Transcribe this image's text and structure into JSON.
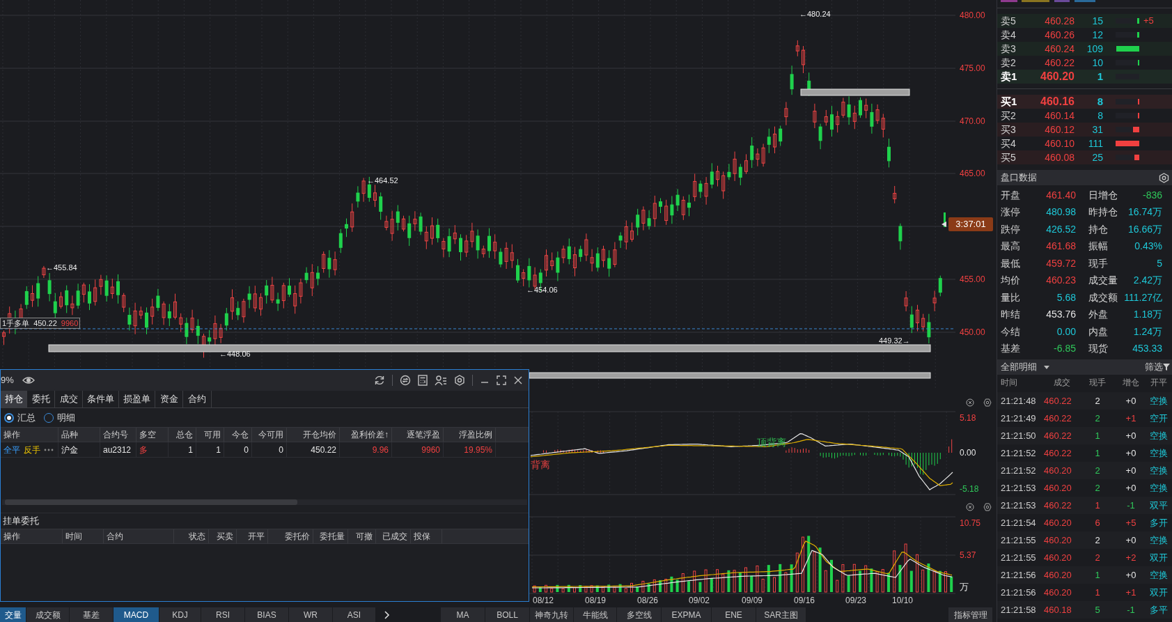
{
  "price_chart": {
    "y_axis": [
      "480.00",
      "475.00",
      "470.00",
      "465.00",
      "455.00",
      "450.00"
    ],
    "extremes": [
      {
        "text": "←480.24"
      },
      {
        "text": "←464.52"
      },
      {
        "text": "←455.84"
      },
      {
        "text": "←454.06"
      },
      {
        "text": "←448.06"
      },
      {
        "text": "449.32→"
      }
    ],
    "position_tag": {
      "label": "1手多单",
      "price": "450.22",
      "pnl": "9960"
    },
    "countdown": "3:37:01"
  },
  "macd_panel": {
    "y_axis": [
      {
        "text": "5.18",
        "color": "#f04040"
      },
      {
        "text": "0.00",
        "color": "#e6e6e6"
      },
      {
        "text": "-5.18",
        "color": "#2fc85a"
      }
    ],
    "signals": [
      {
        "text": "背离",
        "kind": "bottom"
      },
      {
        "text": "顶背离",
        "kind": "top"
      }
    ]
  },
  "volume_panel": {
    "y_axis": [
      "10.75",
      "5.37"
    ],
    "unit": "万"
  },
  "dates": [
    "08/12",
    "08/19",
    "08/26",
    "09/02",
    "09/09",
    "09/16",
    "09/23",
    "10/10"
  ],
  "indicator_tabs": [
    {
      "label": "交量",
      "selected": true
    },
    {
      "label": "成交额",
      "selected": false
    },
    {
      "label": "基差",
      "selected": false
    },
    {
      "label": "MACD",
      "selected": true
    },
    {
      "label": "KDJ",
      "selected": false
    },
    {
      "label": "RSI",
      "selected": false
    },
    {
      "label": "BIAS",
      "selected": false
    },
    {
      "label": "WR",
      "selected": false
    },
    {
      "label": "ASI",
      "selected": false
    }
  ],
  "main_indicator_tabs": [
    "MA",
    "BOLL",
    "神奇九转",
    "牛能线",
    "多空线",
    "EXPMA",
    "ENE",
    "SAR主图"
  ],
  "manage_button": "指标管理",
  "trade_panel": {
    "zoom": "9%",
    "tabs": [
      {
        "label": "持仓",
        "selected": true
      },
      {
        "label": "委托",
        "selected": false
      },
      {
        "label": "成交",
        "selected": false
      },
      {
        "label": "条件单",
        "selected": false
      },
      {
        "label": "损盈单",
        "selected": false
      },
      {
        "label": "资金",
        "selected": false
      },
      {
        "label": "合约",
        "selected": false
      }
    ],
    "views": [
      {
        "label": "汇总",
        "selected": true
      },
      {
        "label": "明细",
        "selected": false
      }
    ],
    "position_columns": [
      "操作",
      "品种",
      "合约号",
      "多空",
      "总仓",
      "可用",
      "今仓",
      "今可用",
      "开仓均价",
      "盈利价差↑",
      "逐笔浮盈",
      "浮盈比例"
    ],
    "positions": [
      {
        "actions": [
          {
            "text": "全平",
            "kind": "close"
          },
          {
            "text": "反手",
            "kind": "reverse"
          }
        ],
        "product": "沪金",
        "contract": "au2312",
        "direction": "多",
        "total": "1",
        "available": "1",
        "today": "0",
        "today_available": "0",
        "avg_price": "450.22",
        "profit_diff": "9.96",
        "float_pnl": "9960",
        "float_ratio": "19.95%"
      }
    ],
    "pending_title": "挂单委托",
    "pending_columns": [
      "操作",
      "时间",
      "合约",
      "状态",
      "买卖",
      "开平",
      "委托价",
      "委托量",
      "可撤",
      "已成交",
      "投保"
    ]
  },
  "order_book": {
    "asks": [
      {
        "label": "卖5",
        "price": "460.28",
        "volume": "15",
        "level": 0.09,
        "best": false,
        "change": "+5"
      },
      {
        "label": "卖4",
        "price": "460.26",
        "volume": "12",
        "level": 0.09,
        "best": false
      },
      {
        "label": "卖3",
        "price": "460.24",
        "volume": "109",
        "level": 0.97,
        "best": false
      },
      {
        "label": "卖2",
        "price": "460.22",
        "volume": "10",
        "level": 0.07,
        "best": false
      },
      {
        "label": "卖1",
        "price": "460.20",
        "volume": "1",
        "best": true
      }
    ],
    "bids": [
      {
        "label": "买1",
        "price": "460.16",
        "volume": "8",
        "level": 0.07,
        "best": true
      },
      {
        "label": "买2",
        "price": "460.14",
        "volume": "8",
        "level": 0.07,
        "best": false
      },
      {
        "label": "买3",
        "price": "460.12",
        "volume": "31",
        "level": 0.28,
        "best": false
      },
      {
        "label": "买4",
        "price": "460.10",
        "volume": "111",
        "level": 1.0,
        "best": false
      },
      {
        "label": "买5",
        "price": "460.08",
        "volume": "25",
        "level": 0.22,
        "best": false
      }
    ]
  },
  "market_stats": {
    "title": "盘口数据",
    "items": [
      {
        "label": "开盘",
        "value": "461.40",
        "color": "#f04040"
      },
      {
        "label": "日增仓",
        "value": "-836",
        "color": "#2fc85a"
      },
      {
        "label": "涨停",
        "value": "480.98",
        "color": "#1ec8d8"
      },
      {
        "label": "昨持仓",
        "value": "16.74万",
        "color": "#1ec8d8"
      },
      {
        "label": "跌停",
        "value": "426.52",
        "color": "#1ec8d8"
      },
      {
        "label": "持仓",
        "value": "16.66万",
        "color": "#1ec8d8"
      },
      {
        "label": "最高",
        "value": "461.68",
        "color": "#f04040"
      },
      {
        "label": "振幅",
        "value": "0.43%",
        "color": "#1ec8d8"
      },
      {
        "label": "最低",
        "value": "459.72",
        "color": "#f04040"
      },
      {
        "label": "现手",
        "value": "5",
        "color": "#1ec8d8"
      },
      {
        "label": "均价",
        "value": "460.23",
        "color": "#f04040"
      },
      {
        "label": "成交量",
        "value": "2.42万",
        "color": "#1ec8d8"
      },
      {
        "label": "量比",
        "value": "5.68",
        "color": "#1ec8d8"
      },
      {
        "label": "成交额",
        "value": "111.27亿",
        "color": "#1ec8d8"
      },
      {
        "label": "昨结",
        "value": "453.76",
        "color": "#e6e6e6"
      },
      {
        "label": "外盘",
        "value": "1.18万",
        "color": "#1ec8d8"
      },
      {
        "label": "今结",
        "value": "0.00",
        "color": "#1ec8d8"
      },
      {
        "label": "内盘",
        "value": "1.24万",
        "color": "#1ec8d8"
      },
      {
        "label": "基差",
        "value": "-6.85",
        "color": "#2fc85a"
      },
      {
        "label": "现货",
        "value": "453.33",
        "color": "#1ec8d8"
      }
    ]
  },
  "trade_detail": {
    "title": "全部明细",
    "filter": "筛选",
    "columns": [
      "时间",
      "成交",
      "现手",
      "增仓",
      "开平"
    ],
    "rows": [
      {
        "time": "21:21:48",
        "price": "460.22",
        "volume": {
          "text": "2",
          "color": "#e6e6e6"
        },
        "change": {
          "text": "+0",
          "color": "#e6e6e6"
        },
        "type": "空换"
      },
      {
        "time": "21:21:49",
        "price": "460.22",
        "volume": {
          "text": "2",
          "color": "#2fc85a"
        },
        "change": {
          "text": "+1",
          "color": "#f04040"
        },
        "type": "空开"
      },
      {
        "time": "21:21:50",
        "price": "460.22",
        "volume": {
          "text": "1",
          "color": "#2fc85a"
        },
        "change": {
          "text": "+0",
          "color": "#e6e6e6"
        },
        "type": "空换"
      },
      {
        "time": "21:21:52",
        "price": "460.22",
        "volume": {
          "text": "1",
          "color": "#2fc85a"
        },
        "change": {
          "text": "+0",
          "color": "#e6e6e6"
        },
        "type": "空换"
      },
      {
        "time": "21:21:52",
        "price": "460.20",
        "volume": {
          "text": "2",
          "color": "#2fc85a"
        },
        "change": {
          "text": "+0",
          "color": "#e6e6e6"
        },
        "type": "空换"
      },
      {
        "time": "21:21:53",
        "price": "460.20",
        "volume": {
          "text": "2",
          "color": "#2fc85a"
        },
        "change": {
          "text": "+0",
          "color": "#e6e6e6"
        },
        "type": "空换"
      },
      {
        "time": "21:21:53",
        "price": "460.22",
        "volume": {
          "text": "1",
          "color": "#f04040"
        },
        "change": {
          "text": "-1",
          "color": "#2fc85a"
        },
        "type": "双平"
      },
      {
        "time": "21:21:54",
        "price": "460.20",
        "volume": {
          "text": "6",
          "color": "#f04040"
        },
        "change": {
          "text": "+5",
          "color": "#f04040"
        },
        "type": "多开"
      },
      {
        "time": "21:21:55",
        "price": "460.20",
        "volume": {
          "text": "2",
          "color": "#e6e6e6"
        },
        "change": {
          "text": "+0",
          "color": "#e6e6e6"
        },
        "type": "空换"
      },
      {
        "time": "21:21:55",
        "price": "460.20",
        "volume": {
          "text": "2",
          "color": "#f04040"
        },
        "change": {
          "text": "+2",
          "color": "#f04040"
        },
        "type": "双开"
      },
      {
        "time": "21:21:56",
        "price": "460.20",
        "volume": {
          "text": "1",
          "color": "#2fc85a"
        },
        "change": {
          "text": "+0",
          "color": "#e6e6e6"
        },
        "type": "空换"
      },
      {
        "time": "21:21:56",
        "price": "460.20",
        "volume": {
          "text": "1",
          "color": "#f04040"
        },
        "change": {
          "text": "+1",
          "color": "#f04040"
        },
        "type": "双开"
      },
      {
        "time": "21:21:58",
        "price": "460.18",
        "volume": {
          "text": "5",
          "color": "#2fc85a"
        },
        "change": {
          "text": "-1",
          "color": "#2fc85a"
        },
        "type": "多平"
      }
    ]
  }
}
